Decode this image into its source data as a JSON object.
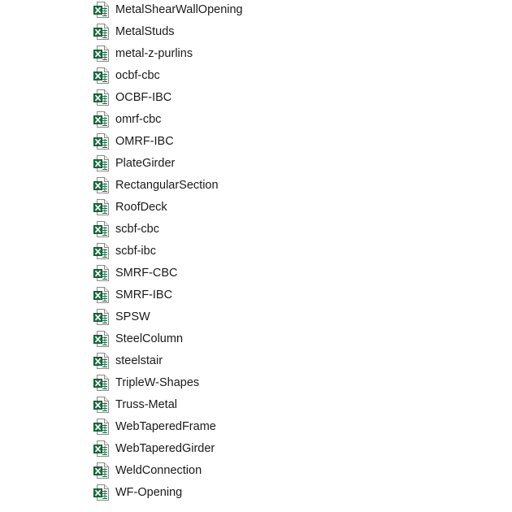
{
  "files": [
    {
      "name": "MetalShearWallOpening",
      "icon": "excel-file-icon"
    },
    {
      "name": "MetalStuds",
      "icon": "excel-file-icon"
    },
    {
      "name": "metal-z-purlins",
      "icon": "excel-file-icon"
    },
    {
      "name": "ocbf-cbc",
      "icon": "excel-file-icon"
    },
    {
      "name": "OCBF-IBC",
      "icon": "excel-file-icon"
    },
    {
      "name": "omrf-cbc",
      "icon": "excel-file-icon"
    },
    {
      "name": "OMRF-IBC",
      "icon": "excel-file-icon"
    },
    {
      "name": "PlateGirder",
      "icon": "excel-file-icon"
    },
    {
      "name": "RectangularSection",
      "icon": "excel-file-icon"
    },
    {
      "name": "RoofDeck",
      "icon": "excel-file-icon"
    },
    {
      "name": "scbf-cbc",
      "icon": "excel-file-icon"
    },
    {
      "name": "scbf-ibc",
      "icon": "excel-file-icon"
    },
    {
      "name": "SMRF-CBC",
      "icon": "excel-file-icon"
    },
    {
      "name": "SMRF-IBC",
      "icon": "excel-file-icon"
    },
    {
      "name": "SPSW",
      "icon": "excel-file-icon"
    },
    {
      "name": "SteelColumn",
      "icon": "excel-file-icon"
    },
    {
      "name": "steelstair",
      "icon": "excel-file-icon"
    },
    {
      "name": "TripleW-Shapes",
      "icon": "excel-file-icon"
    },
    {
      "name": "Truss-Metal",
      "icon": "excel-file-icon"
    },
    {
      "name": "WebTaperedFrame",
      "icon": "excel-file-icon"
    },
    {
      "name": "WebTaperedGirder",
      "icon": "excel-file-icon"
    },
    {
      "name": "WeldConnection",
      "icon": "excel-file-icon"
    },
    {
      "name": "WF-Opening",
      "icon": "excel-file-icon"
    }
  ],
  "colors": {
    "excel_green": "#1d7044",
    "text": "#1a1a1a",
    "background": "#ffffff"
  }
}
